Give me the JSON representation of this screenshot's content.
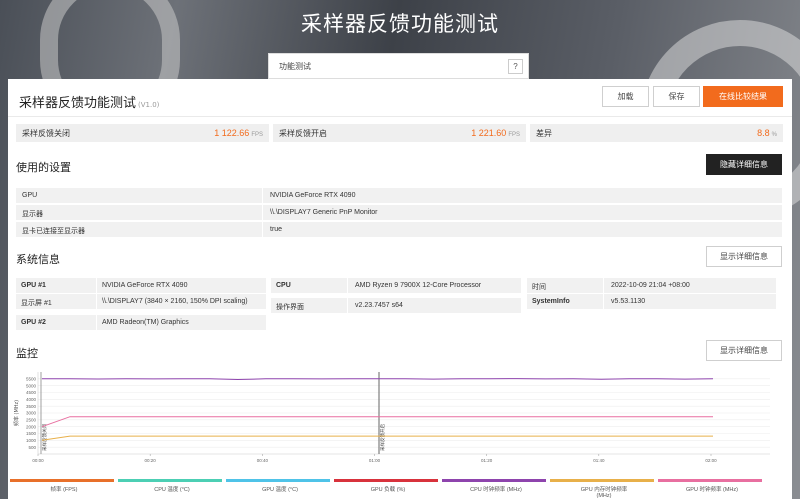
{
  "page_title": "采样器反馈功能测试",
  "tab": {
    "label": "功能测试",
    "help": "?"
  },
  "header": {
    "title": "采样器反馈功能测试",
    "version": "(V1.0)"
  },
  "buttons": {
    "load": "加载",
    "save": "保存",
    "compare": "在线比较结果",
    "hide_details": "隐藏详细信息",
    "show_details": "显示详细信息"
  },
  "scores": [
    {
      "label": "采样反馈关闭",
      "value": "1 122.66",
      "unit": "FPS"
    },
    {
      "label": "采样反馈开启",
      "value": "1 221.60",
      "unit": "FPS"
    },
    {
      "label": "差异",
      "value": "8.8",
      "unit": "%"
    }
  ],
  "settings": {
    "title": "使用的设置",
    "rows": [
      {
        "key": "GPU",
        "value": "NVIDIA GeForce RTX 4090"
      },
      {
        "key": "显示器",
        "value": "\\\\.\\DISPLAY7 Generic PnP Monitor"
      },
      {
        "key": "显卡已连接至显示器",
        "value": "true"
      }
    ]
  },
  "system": {
    "title": "系统信息",
    "gpu1_k": "GPU #1",
    "gpu1_v": "NVIDIA GeForce RTX 4090",
    "display1_k": "显示屏 #1",
    "display1_v": "\\\\.\\DISPLAY7 (3840 × 2160, 150% DPI scaling)",
    "gpu2_k": "GPU #2",
    "gpu2_v": "AMD Radeon(TM) Graphics",
    "cpu_k": "CPU",
    "cpu_v": "AMD Ryzen 9 7900X 12-Core Processor",
    "os_k": "操作界面",
    "os_v": "v2.23.7457 s64",
    "time_k": "时间",
    "time_v": "2022-10-09 21:04 +08:00",
    "sysinfo_k": "SystemInfo",
    "sysinfo_v": "v5.53.1130"
  },
  "monitor": {
    "title": "监控",
    "ylabel": "频率 (MHz)",
    "marker1": "采样反馈关闭",
    "marker2": "采样反馈开启",
    "yticks": [
      "5500",
      "5000",
      "4500",
      "4000",
      "3500",
      "3000",
      "2500",
      "2000",
      "1500",
      "1000",
      "500"
    ],
    "xticks": [
      "00:00",
      "00:20",
      "00:40",
      "01:00",
      "01:20",
      "01:40",
      "02:00"
    ],
    "legend": [
      {
        "label": "帧率 (FPS)",
        "color": "#e8702a"
      },
      {
        "label": "CPU 温度 (°C)",
        "color": "#4ccfb4"
      },
      {
        "label": "GPU 温度 (°C)",
        "color": "#4fc3e8"
      },
      {
        "label": "GPU 负载 (%)",
        "color": "#d8323c"
      },
      {
        "label": "CPU 时钟频率 (MHz)",
        "color": "#8e44ad"
      },
      {
        "label": "GPU 内存时钟频率 (MHz)",
        "color": "#e8b04a"
      },
      {
        "label": "GPU 时钟频率 (MHz)",
        "color": "#e86fa0"
      }
    ]
  },
  "chart_data": {
    "type": "line",
    "ylabel": "频率 (MHz)",
    "ylim": [
      0,
      6000
    ],
    "x_labels": [
      "00:00",
      "00:20",
      "00:40",
      "01:00",
      "01:20",
      "01:40",
      "02:00"
    ],
    "series": [
      {
        "name": "CPU 时钟频率 (MHz)",
        "color": "#8e44ad",
        "values": [
          5500,
          5510,
          5490,
          5505,
          5495,
          5500,
          5510,
          5450,
          5500,
          5505,
          5495,
          5500,
          5505,
          5500,
          5480,
          5500,
          5510,
          5520,
          5495,
          5500,
          5470,
          5500,
          5505,
          5480,
          5500
        ]
      },
      {
        "name": "GPU 时钟频率 (MHz)",
        "color": "#e86fa0",
        "values": [
          2000,
          2730,
          2730,
          2730,
          2730,
          2730,
          2730,
          2730,
          2730,
          2730,
          2730,
          2730,
          2730,
          2730,
          2730,
          2730,
          2730,
          2730,
          2730,
          2730,
          2730,
          2730,
          2730,
          2730,
          2730
        ]
      },
      {
        "name": "GPU 内存时钟频率 (MHz)",
        "color": "#e8b04a",
        "values": [
          1000,
          1313,
          1313,
          1313,
          1313,
          1313,
          1313,
          1313,
          1313,
          1313,
          1313,
          1313,
          1313,
          1313,
          1313,
          1313,
          1313,
          1313,
          1313,
          1313,
          1313,
          1313,
          1313,
          1313,
          1313
        ]
      }
    ]
  }
}
